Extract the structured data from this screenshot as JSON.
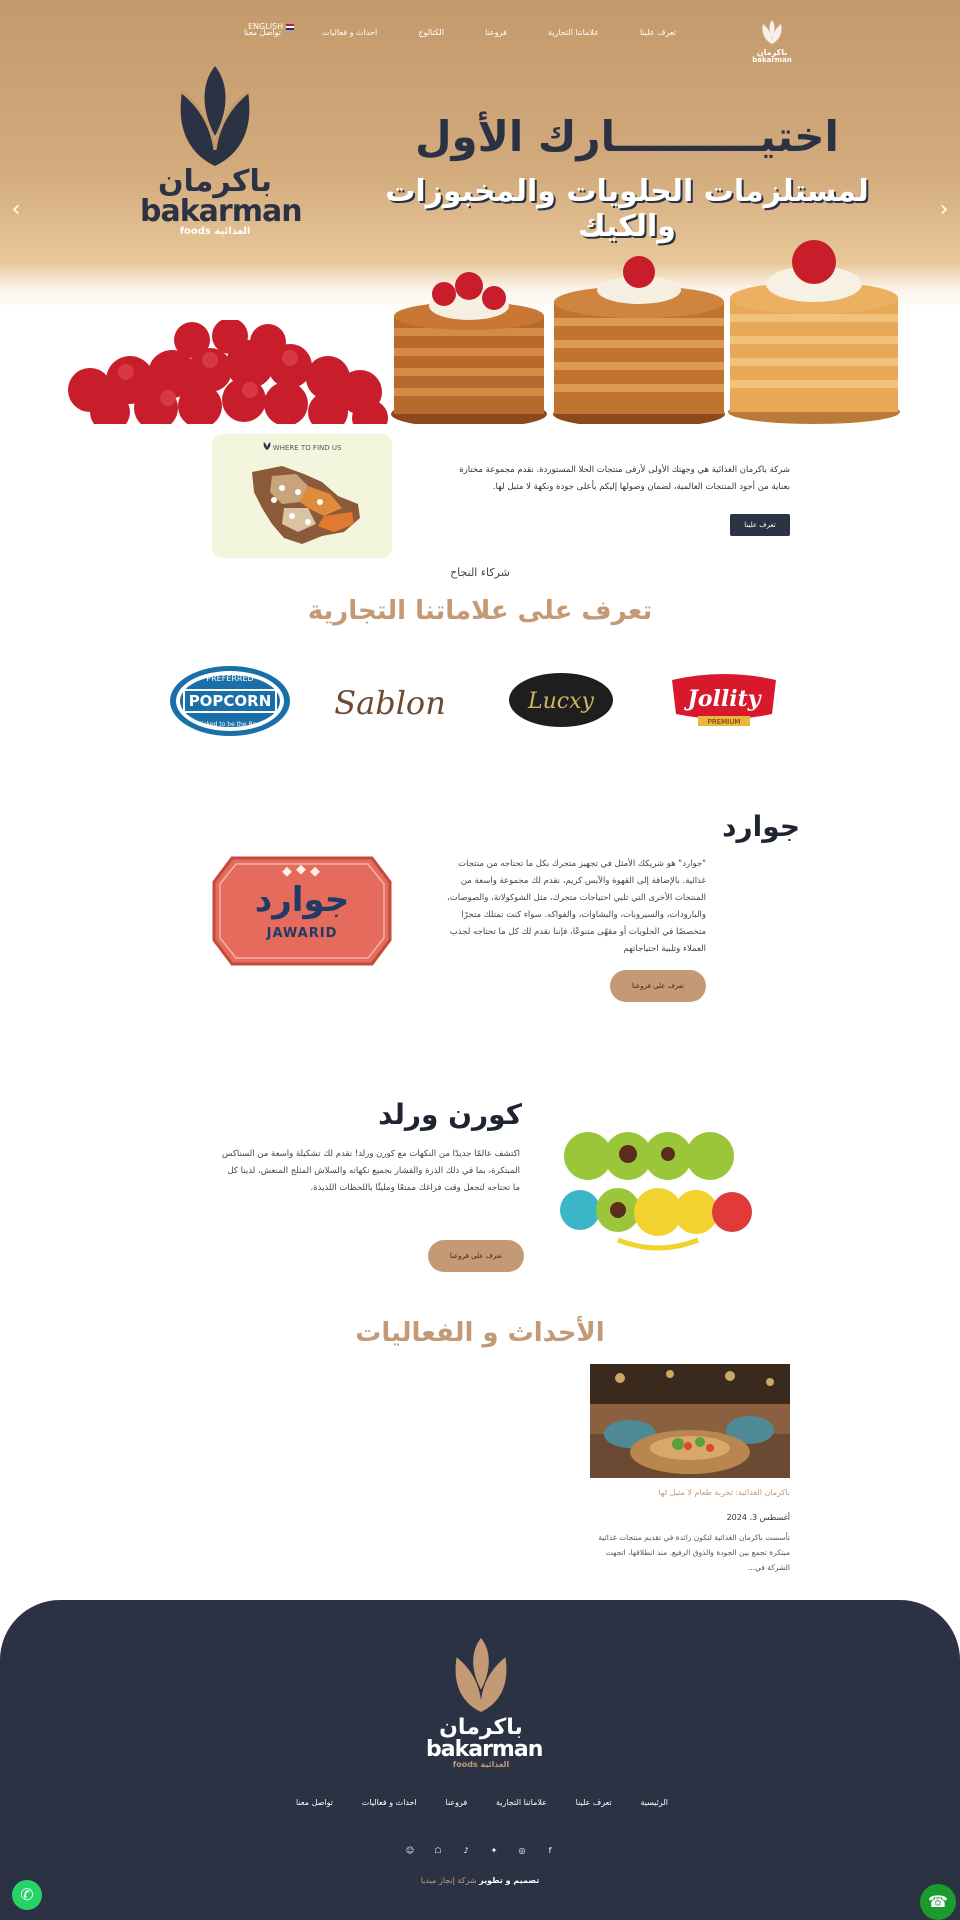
{
  "nav": {
    "items": [
      "تعرف علينا",
      "علاماتنا التجارية",
      "فروعنا",
      "الكتالوج",
      "احداث و فعاليات",
      "تواصل معنا"
    ],
    "lang": "ENGLISH",
    "logo_ar": "باكرمان",
    "logo_en": "bakarman"
  },
  "hero": {
    "headline1": "اختيــــــــــارك الأول",
    "headline2": "لمستلزمات الحلويات والمخبوزات والكيك",
    "logo_ar": "باكرمان",
    "logo_en": "bakarman",
    "logo_sub_en": "foods",
    "logo_sub_ar": "الغذائية",
    "prev_icon": "chevron-left-icon",
    "next_icon": "chevron-right-icon"
  },
  "intro": {
    "map_heading": "WHERE TO FIND US",
    "text": "شركة باكرمان الغذائية هي وجهتك الأولى لأرقى منتجات الحلا المستوردة. نقدم مجموعة مختارة بعناية من أجود المنتجات العالمية، لضمان وصولها إليكم بأعلى جودة ونكهة لا مثيل لها.",
    "button": "تعرف علينا"
  },
  "brands": {
    "label": "شركاء النجاح",
    "title": "تعرف على علاماتنا التجارية",
    "logos": [
      "Jollity",
      "PREMIUM",
      "Lucxy",
      "Sablon",
      "PREFERRED",
      "POPCORN",
      "Picked to be the Best"
    ]
  },
  "jawarid": {
    "title": "جوارد",
    "text": "\"جوارد\" هو شريكك الأمثل في تجهيز متجرك بكل ما تحتاجه من منتجات غذائية. بالإضافة إلى القهوة والآيس كريم، نقدم لك مجموعة واسعة من المنتجات الأخرى التي تلبي احتياجات متجرك، مثل الشوكولاتة، والصوصات، والبارودات، والسيروبات، والبشاوات، والفواكه. سواء كنت تمتلك متجرًا متخصصًا في الحلويات أو مقهًى متنوعًا، فإننا نقدم لك كل ما تحتاجه لجذب العملاء وتلبية احتياجاتهم",
    "logo_ar": "جوارد",
    "logo_en": "JAWARID",
    "button": "تعرف على فروعنا"
  },
  "cornworld": {
    "title": "كورن ورلد",
    "text": "اكتشف عالمًا جديدًا من النكهات مع كورن ورلد! نقدم لك تشكيلة واسعة من السناكس المبتكرة، بما في ذلك الذرة والفشار بجميع نكهاته والسلاش المثلج المنعش، لدينا كل ما تحتاجه لتجعل وقت فراغك ممتعًا ومليئًا باللحظات اللذيذة.",
    "button": "تعرف على فروعنا"
  },
  "events": {
    "title": "الأحداث و الفعاليات",
    "card_link": "باكرمان الغذائية: تجربة طعام لا مثيل لها",
    "card_date": "أغسطس 3، 2024",
    "card_desc": "تأسست باكرمان الغذائية لتكون رائدة في تقديم منتجات غذائية مبتكرة تجمع بين الجودة والذوق الرفيع. منذ انطلاقها، اتجهت الشركة في..."
  },
  "footer": {
    "logo_ar": "باكرمان",
    "logo_en": "bakarman",
    "logo_sub_en": "foods",
    "logo_sub_ar": "الغذائية",
    "nav": [
      "الرئيسية",
      "تعرف علينا",
      "علاماتنا التجارية",
      "فروعنا",
      "احداث و فعاليات",
      "تواصل معنا"
    ],
    "socials": [
      "facebook-icon",
      "instagram-icon",
      "twitter-icon",
      "tiktok-icon",
      "snapchat-icon",
      "discord-icon"
    ],
    "credit_prefix": "تصميم و تطوير",
    "credit_company": "شركة إنجاز ميديا"
  },
  "colors": {
    "navy": "#2b3244",
    "tan": "#c49a76",
    "whatsapp": "#25d366",
    "call": "#1a9b2c"
  }
}
